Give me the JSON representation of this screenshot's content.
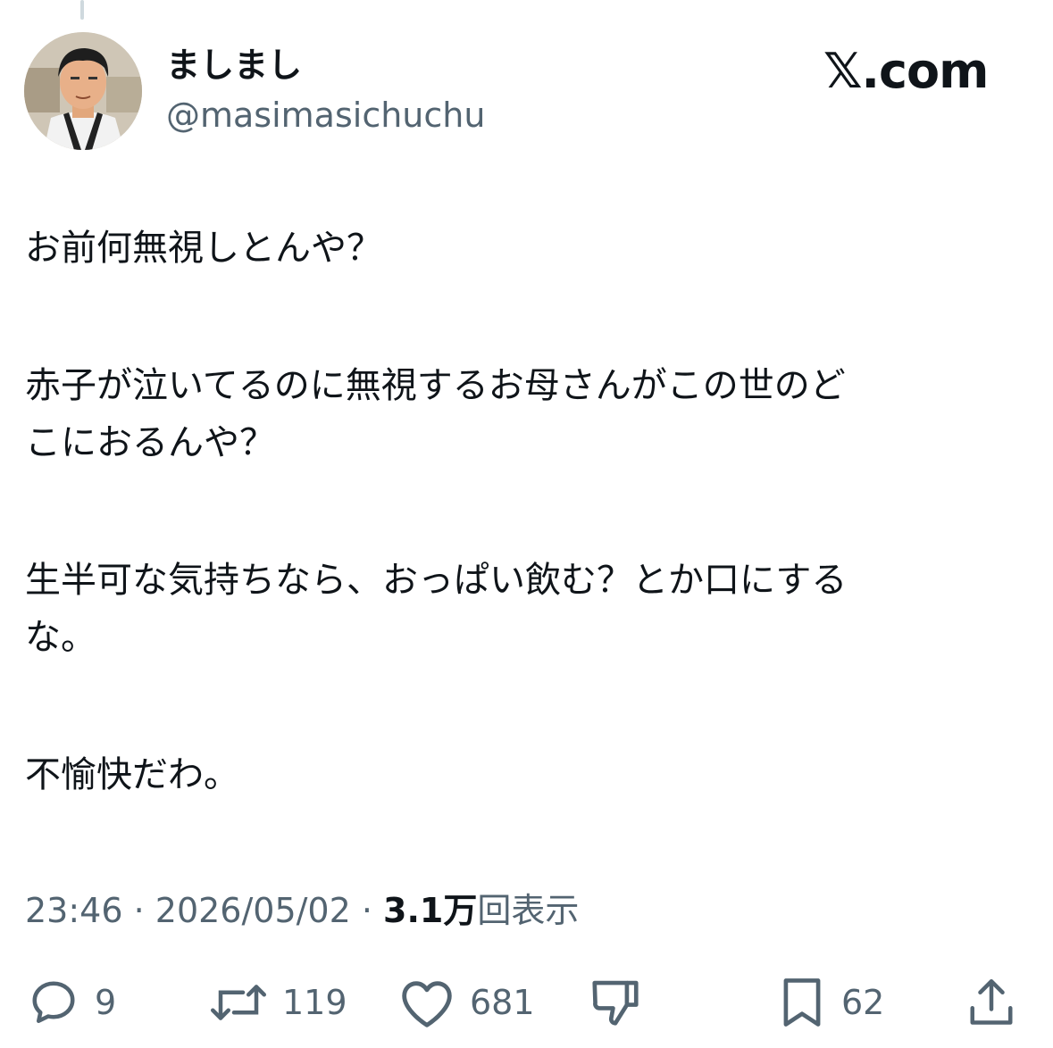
{
  "author": {
    "display_name": "ましまし",
    "handle": "@masimasichuchu"
  },
  "brand": "𝕏.com",
  "tweet": {
    "paragraphs": [
      [
        "お前何無視しとんや？"
      ],
      [
        "赤子が泣いてるのに無視するお母さんがこの世のど",
        "こにおるんや？"
      ],
      [
        "生半可な気持ちなら、おっぱい飲む？とか口にする",
        "な。"
      ],
      [
        "不愉快だわ。"
      ]
    ]
  },
  "meta": {
    "time": "23:46",
    "separator": " · ",
    "date": "2026/05/02",
    "views_count": "3.1万",
    "views_label": "回表示"
  },
  "actions": {
    "replies": "9",
    "reposts": "119",
    "likes": "681",
    "bookmarks": "62"
  },
  "icons": [
    "reply-icon",
    "repost-icon",
    "like-icon",
    "dislike-icon",
    "bookmark-icon",
    "share-icon"
  ],
  "colors": {
    "text": "#0f1419",
    "secondary": "#536471",
    "thread_line": "#cfd9de"
  }
}
